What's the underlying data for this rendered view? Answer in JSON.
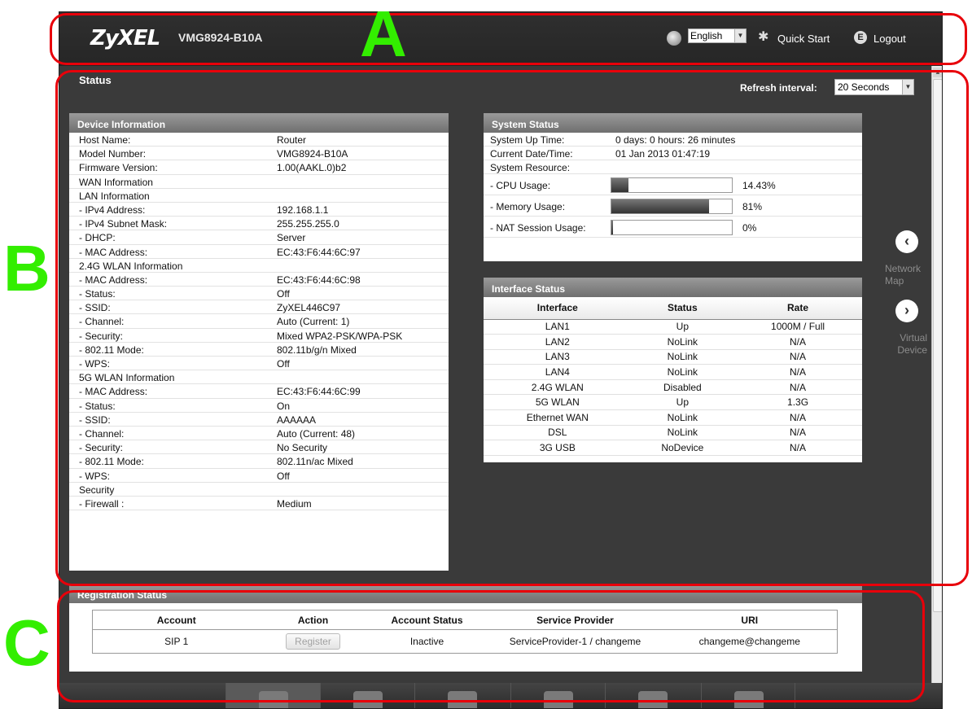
{
  "header": {
    "brand": "ZyXEL",
    "model": "VMG8924-B10A",
    "language": "English",
    "quick_start": "Quick Start",
    "logout": "Logout"
  },
  "page": {
    "title": "Status",
    "refresh_label": "Refresh interval:",
    "refresh_value": "20 Seconds"
  },
  "device_info": {
    "title": "Device Information",
    "rows": [
      {
        "label": "Host Name:",
        "value": "Router"
      },
      {
        "label": "Model Number:",
        "value": "VMG8924-B10A"
      },
      {
        "label": "Firmware Version:",
        "value": "1.00(AAKL.0)b2"
      },
      {
        "label": "WAN Information",
        "value": ""
      },
      {
        "label": "LAN Information",
        "value": ""
      },
      {
        "label": " - IPv4 Address:",
        "value": "192.168.1.1"
      },
      {
        "label": " - IPv4 Subnet Mask:",
        "value": "255.255.255.0"
      },
      {
        "label": " - DHCP:",
        "value": "Server"
      },
      {
        "label": " - MAC Address:",
        "value": "EC:43:F6:44:6C:97"
      },
      {
        "label": "2.4G WLAN Information",
        "value": ""
      },
      {
        "label": " - MAC Address:",
        "value": "EC:43:F6:44:6C:98"
      },
      {
        "label": " - Status:",
        "value": "Off"
      },
      {
        "label": " - SSID:",
        "value": "ZyXEL446C97"
      },
      {
        "label": " - Channel:",
        "value": "Auto (Current: 1)"
      },
      {
        "label": " - Security:",
        "value": "Mixed WPA2-PSK/WPA-PSK"
      },
      {
        "label": " - 802.11 Mode:",
        "value": "802.11b/g/n Mixed"
      },
      {
        "label": " - WPS:",
        "value": "Off"
      },
      {
        "label": "5G WLAN Information",
        "value": ""
      },
      {
        "label": " - MAC Address:",
        "value": "EC:43:F6:44:6C:99"
      },
      {
        "label": " - Status:",
        "value": "On"
      },
      {
        "label": " - SSID:",
        "value": "AAAAAA"
      },
      {
        "label": " - Channel:",
        "value": "Auto (Current: 48)"
      },
      {
        "label": " - Security:",
        "value": "No Security"
      },
      {
        "label": " - 802.11 Mode:",
        "value": "802.11n/ac Mixed"
      },
      {
        "label": " - WPS:",
        "value": "Off"
      },
      {
        "label": "Security",
        "value": ""
      },
      {
        "label": " - Firewall :",
        "value": "Medium"
      }
    ]
  },
  "system_status": {
    "title": "System Status",
    "up_time_label": "System Up Time:",
    "up_time": "0 days: 0 hours: 26 minutes",
    "date_time_label": "Current Date/Time:",
    "date_time": "01 Jan 2013 01:47:19",
    "resource_label": "System Resource:",
    "resources": [
      {
        "label": " - CPU Usage:",
        "percent": "14.43%",
        "fraction": 0.1443
      },
      {
        "label": " - Memory Usage:",
        "percent": "81%",
        "fraction": 0.81
      },
      {
        "label": " - NAT Session Usage:",
        "percent": "0%",
        "fraction": 0.0
      }
    ]
  },
  "interface_status": {
    "title": "Interface Status",
    "columns": [
      "Interface",
      "Status",
      "Rate"
    ],
    "rows": [
      [
        "LAN1",
        "Up",
        "1000M / Full"
      ],
      [
        "LAN2",
        "NoLink",
        "N/A"
      ],
      [
        "LAN3",
        "NoLink",
        "N/A"
      ],
      [
        "LAN4",
        "NoLink",
        "N/A"
      ],
      [
        "2.4G WLAN",
        "Disabled",
        "N/A"
      ],
      [
        "5G WLAN",
        "Up",
        "1.3G"
      ],
      [
        "Ethernet WAN",
        "NoLink",
        "N/A"
      ],
      [
        "DSL",
        "NoLink",
        "N/A"
      ],
      [
        "3G USB",
        "NoDevice",
        "N/A"
      ]
    ]
  },
  "side_nav": {
    "network_map": "Network Map",
    "virtual_device": "Virtual Device"
  },
  "registration": {
    "title": "Registration Status",
    "columns": [
      "Account",
      "Action",
      "Account Status",
      "Service Provider",
      "URI"
    ],
    "rows": [
      {
        "account": "SIP 1",
        "action": "Register",
        "status": "Inactive",
        "provider": "ServiceProvider-1 / changeme",
        "uri": "changeme@changeme"
      }
    ]
  },
  "annotations": {
    "a": "A",
    "b": "B",
    "c": "C",
    "box_color": "#e8000a",
    "letter_color": "#33ee00"
  }
}
